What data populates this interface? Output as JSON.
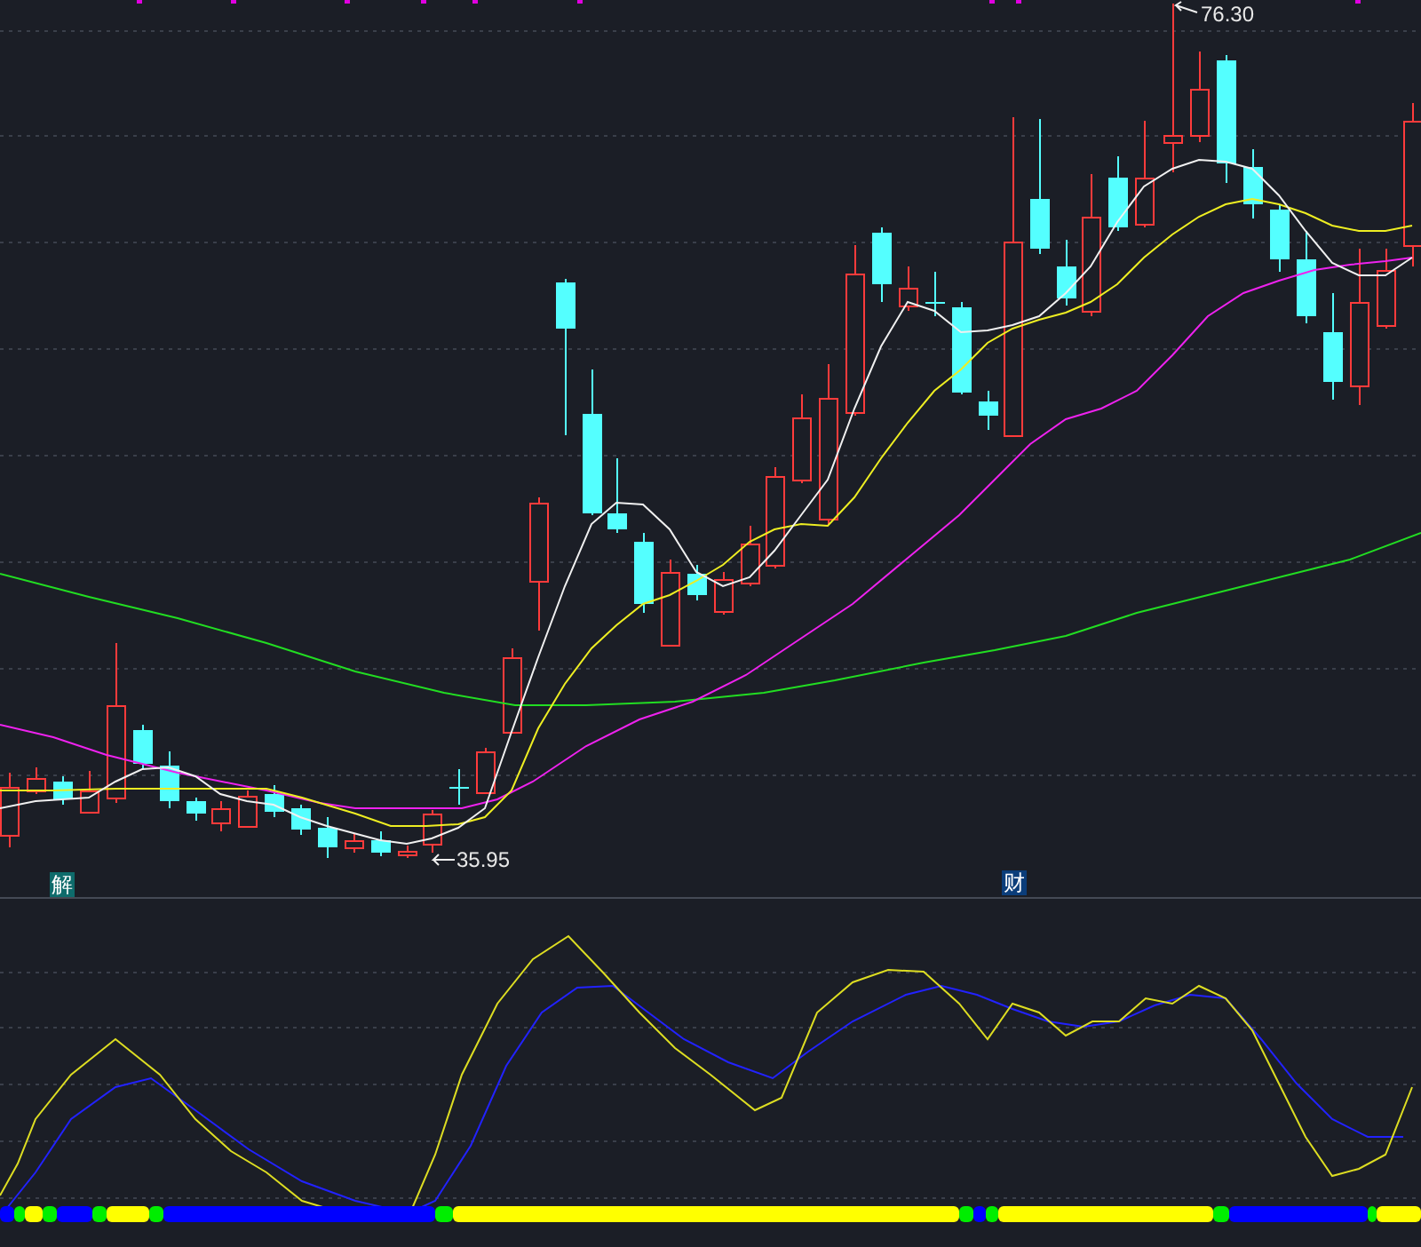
{
  "price_panel": {
    "high_label": "76.30",
    "low_label": "35.95",
    "markers": [
      {
        "text": "解",
        "color": "#0e6b6b"
      },
      {
        "text": "财",
        "color": "#0b3d7a"
      }
    ]
  }
}
